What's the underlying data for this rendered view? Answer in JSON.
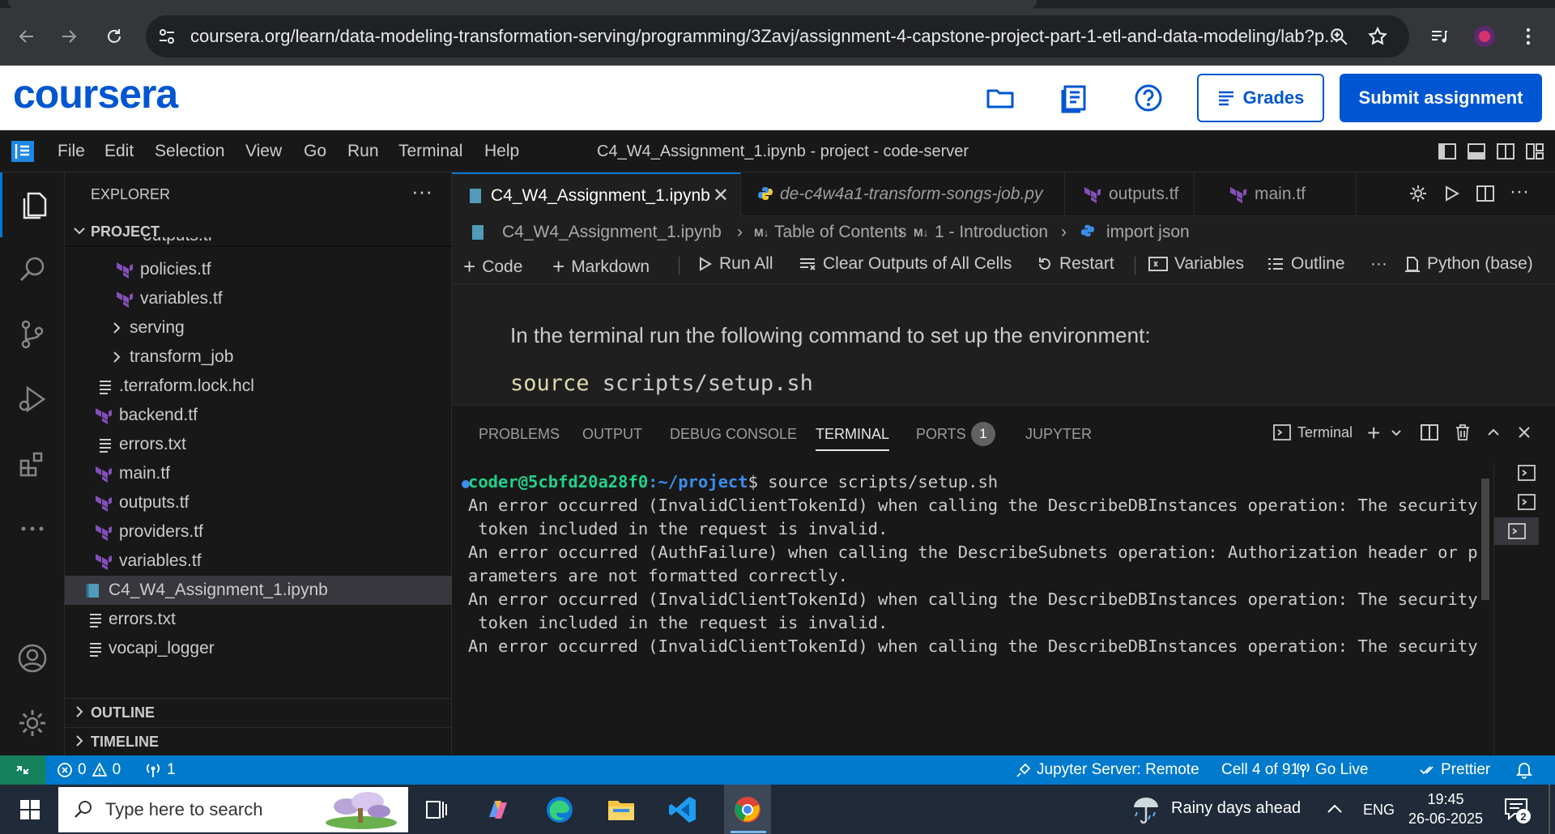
{
  "browser": {
    "url": "coursera.org/learn/data-modeling-transformation-serving/programming/3Zavj/assignment-4-capstone-project-part-1-etl-and-data-modeling/lab?p..."
  },
  "coursera": {
    "logo": "coursera",
    "grades_label": "Grades",
    "submit_label": "Submit assignment"
  },
  "menubar": {
    "items": [
      "File",
      "Edit",
      "Selection",
      "View",
      "Go",
      "Run",
      "Terminal",
      "Help"
    ],
    "window_title": "C4_W4_Assignment_1.ipynb - project - code-server"
  },
  "sidebar": {
    "title": "EXPLORER",
    "dots": "···",
    "project_label": "PROJECT",
    "partial_item": "outputs.tf",
    "items": [
      {
        "name": "policies.tf",
        "type": "tf"
      },
      {
        "name": "variables.tf",
        "type": "tf"
      },
      {
        "name": "serving",
        "type": "folder"
      },
      {
        "name": "transform_job",
        "type": "folder"
      },
      {
        "name": ".terraform.lock.hcl",
        "type": "text"
      },
      {
        "name": "backend.tf",
        "type": "tf"
      },
      {
        "name": "errors.txt",
        "type": "text"
      },
      {
        "name": "main.tf",
        "type": "tf"
      },
      {
        "name": "outputs.tf",
        "type": "tf"
      },
      {
        "name": "providers.tf",
        "type": "tf"
      },
      {
        "name": "variables.tf",
        "type": "tf"
      },
      {
        "name": "C4_W4_Assignment_1.ipynb",
        "type": "notebook"
      },
      {
        "name": "errors.txt",
        "type": "text"
      },
      {
        "name": "vocapi_logger",
        "type": "text"
      }
    ],
    "outline_label": "OUTLINE",
    "timeline_label": "TIMELINE"
  },
  "tabs": [
    {
      "label": "C4_W4_Assignment_1.ipynb",
      "active": true,
      "close": "✕"
    },
    {
      "label": "de-c4w4a1-transform-songs-job.py",
      "active": false
    },
    {
      "label": "outputs.tf",
      "active": false
    },
    {
      "label": "main.tf",
      "active": false
    }
  ],
  "breadcrumb": {
    "file": "C4_W4_Assignment_1.ipynb",
    "toc": "Table of Contents",
    "section": "1 - Introduction",
    "cell": "import json",
    "md_prefix1": "M↓",
    "md_prefix2": "M↓"
  },
  "notebook_toolbar": {
    "code": "Code",
    "markdown": "Markdown",
    "run_all": "Run All",
    "clear": "Clear Outputs of All Cells",
    "restart": "Restart",
    "variables": "Variables",
    "outline": "Outline",
    "more": "···",
    "kernel": "Python (base)"
  },
  "notebook": {
    "markdown_text": "In the terminal run the following command to set up the environment:",
    "code_kw": "source",
    "code_rest": " scripts/setup.sh"
  },
  "panel": {
    "tabs": [
      "PROBLEMS",
      "OUTPUT",
      "DEBUG CONSOLE",
      "TERMINAL",
      "PORTS",
      "JUPYTER"
    ],
    "ports_count": "1",
    "terminal_label": "Terminal"
  },
  "terminal": {
    "prompt_user": "coder@5cbfd20a28f0",
    "prompt_path": ":~/project",
    "prompt_end": "$ ",
    "command": "source scripts/setup.sh",
    "lines": [
      "",
      "An error occurred (InvalidClientTokenId) when calling the DescribeDBInstances operation: The security",
      " token included in the request is invalid.",
      "",
      "An error occurred (AuthFailure) when calling the DescribeSubnets operation: Authorization header or p",
      "arameters are not formatted correctly.",
      "",
      "An error occurred (InvalidClientTokenId) when calling the DescribeDBInstances operation: The security",
      " token included in the request is invalid.",
      "",
      "An error occurred (InvalidClientTokenId) when calling the DescribeDBInstances operation: The security"
    ]
  },
  "statusbar": {
    "errors": "0",
    "warnings": "0",
    "ports": "1",
    "jupyter": "Jupyter Server: Remote",
    "cell": "Cell 4 of 91",
    "golive": "Go Live",
    "prettier": "Prettier"
  },
  "taskbar": {
    "search_placeholder": "Type here to search",
    "weather": "Rainy days ahead",
    "lang": "ENG",
    "time": "19:45",
    "date": "26-06-2025",
    "notif_count": "2"
  },
  "colors": {
    "accent": "#0078d4",
    "coursera_blue": "#0056d2",
    "statusbar": "#007acc",
    "terraform": "#844fba"
  }
}
